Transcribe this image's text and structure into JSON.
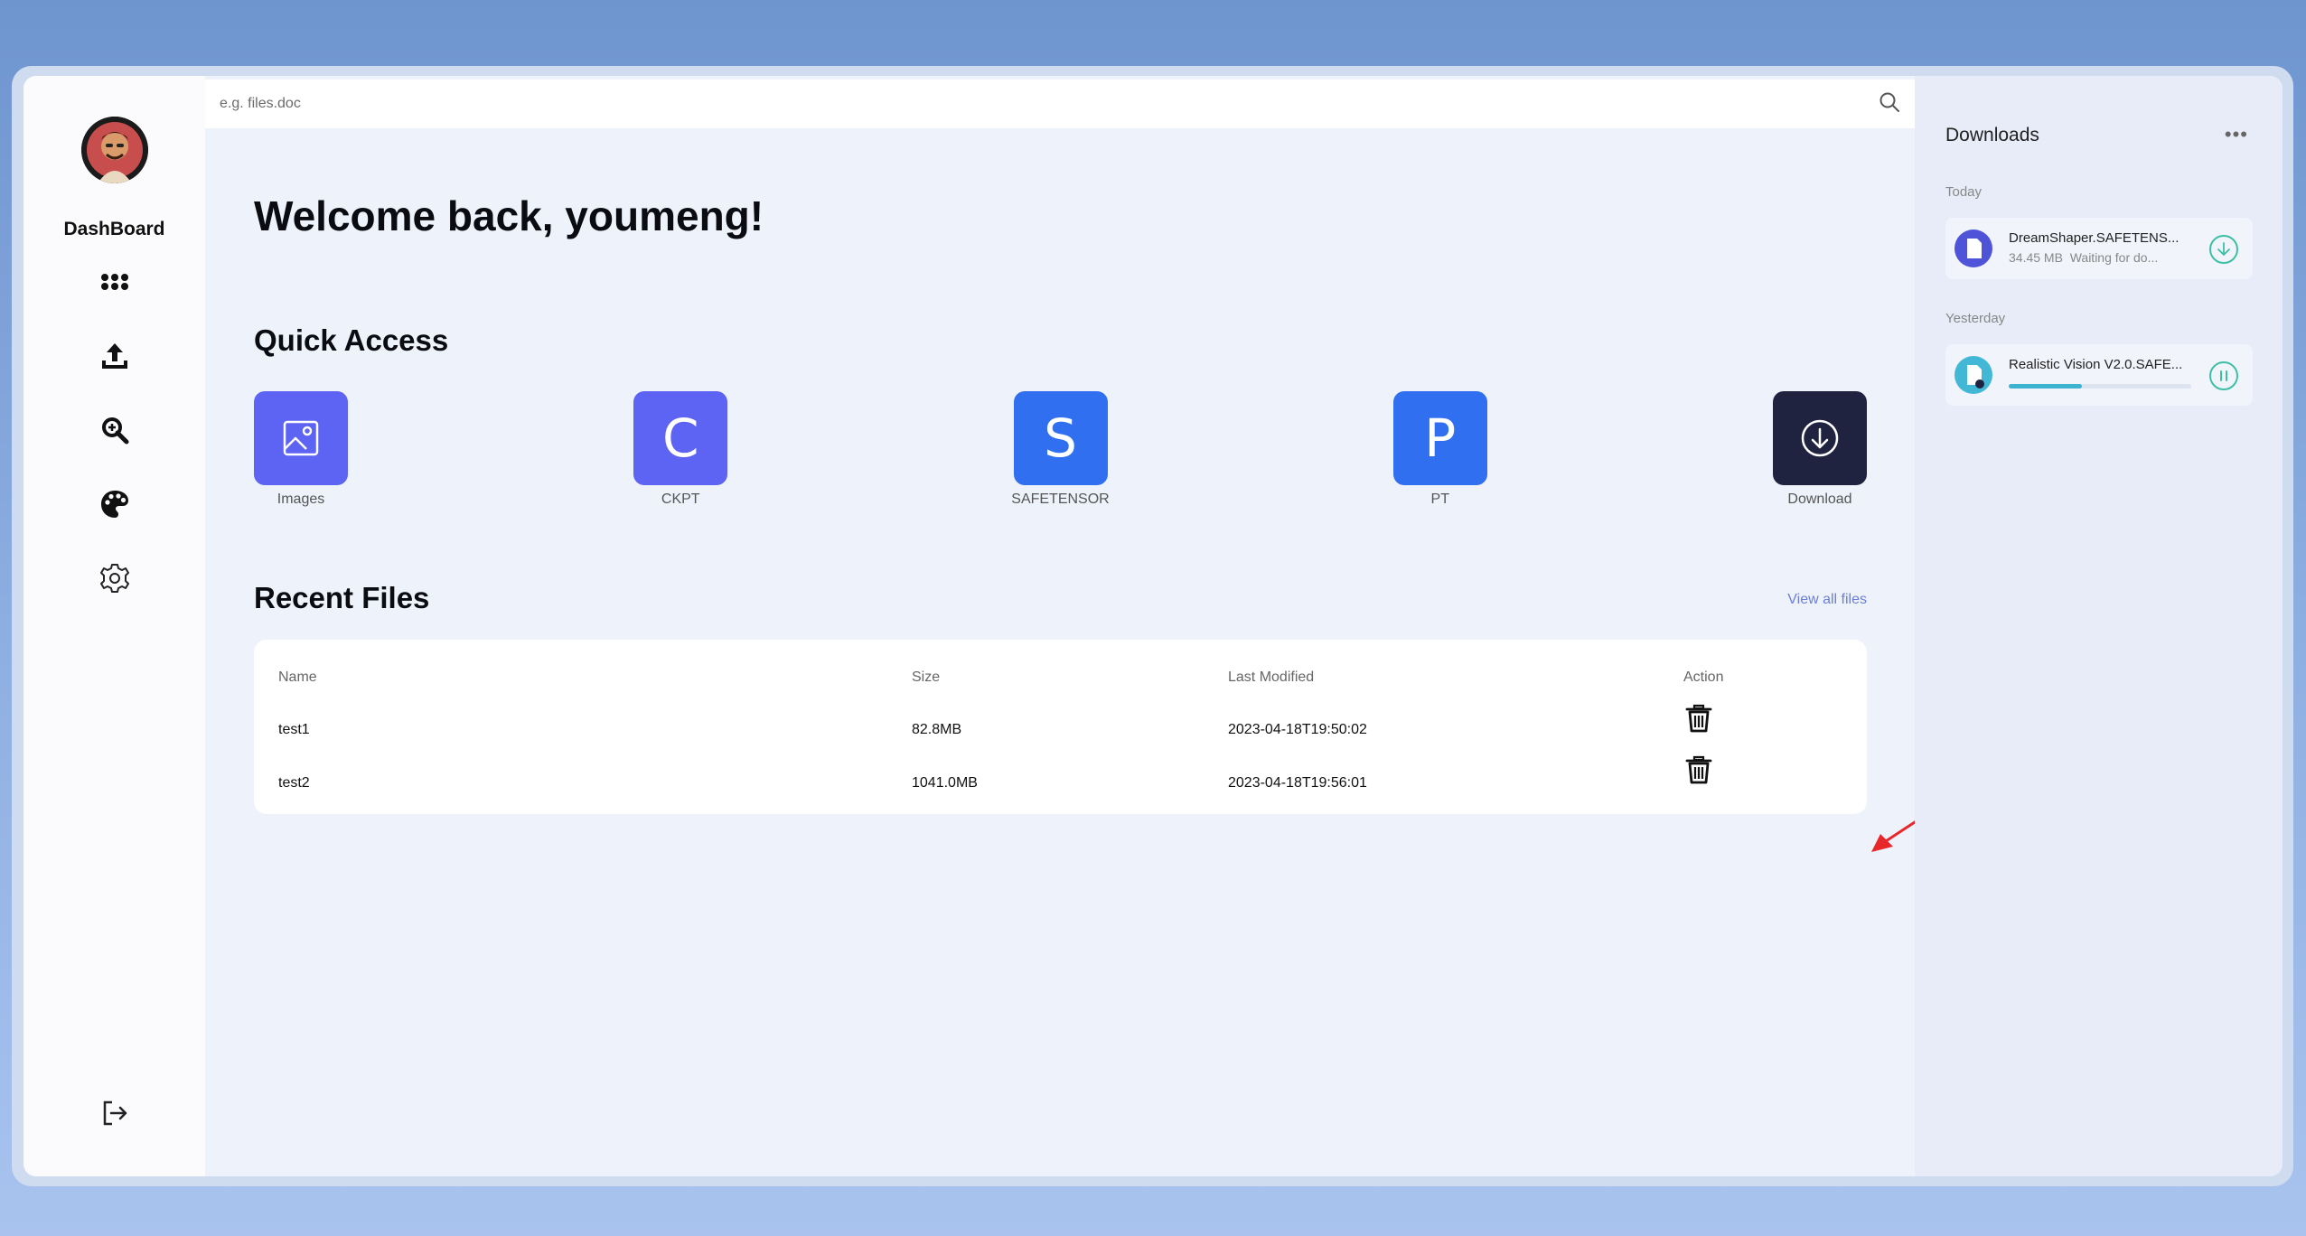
{
  "sidebar": {
    "brand": "DashBoard",
    "nav": [
      {
        "name": "grid-icon"
      },
      {
        "name": "upload-icon"
      },
      {
        "name": "search-zoom-icon"
      },
      {
        "name": "palette-icon"
      },
      {
        "name": "gear-icon"
      }
    ],
    "logout_icon": "logout-icon"
  },
  "search": {
    "placeholder": "e.g. files.doc",
    "value": ""
  },
  "main": {
    "welcome": "Welcome back, youmeng!",
    "quick_access_title": "Quick Access",
    "quick_access": [
      {
        "label": "Images",
        "glyph": "",
        "color": "#5d63f2",
        "icon": "image-icon"
      },
      {
        "label": "CKPT",
        "glyph": "C",
        "color": "#5d63f2",
        "icon": ""
      },
      {
        "label": "SAFETENSOR",
        "glyph": "S",
        "color": "#2f6ff0",
        "icon": ""
      },
      {
        "label": "PT",
        "glyph": "P",
        "color": "#2f6ff0",
        "icon": ""
      },
      {
        "label": "Download",
        "glyph": "",
        "color": "#1f2340",
        "icon": "download-circle-icon"
      }
    ],
    "recent_title": "Recent Files",
    "view_all": "View all files",
    "table": {
      "headers": [
        "Name",
        "Size",
        "Last Modified",
        "Action"
      ],
      "rows": [
        {
          "name": "test1",
          "size": "82.8MB",
          "modified": "2023-04-18T19:50:02"
        },
        {
          "name": "test2",
          "size": "1041.0MB",
          "modified": "2023-04-18T19:56:01"
        }
      ]
    }
  },
  "downloads": {
    "title": "Downloads",
    "more": "•••",
    "groups": [
      {
        "label": "Today",
        "item": {
          "name": "DreamShaper.SAFETENS...",
          "size": "34.45 MB",
          "status": "Waiting for do...",
          "icon_color": "#4e53d8"
        }
      },
      {
        "label": "Yesterday",
        "item": {
          "name": "Realistic Vision V2.0.SAFE...",
          "progress": 0.4,
          "icon_color": "#42b8d6"
        }
      }
    ]
  },
  "colors": {
    "accent": "#5d63f2",
    "teal": "#3cc0a5",
    "link": "#6b7fd8",
    "annotation_arrow": "#e8272a"
  }
}
